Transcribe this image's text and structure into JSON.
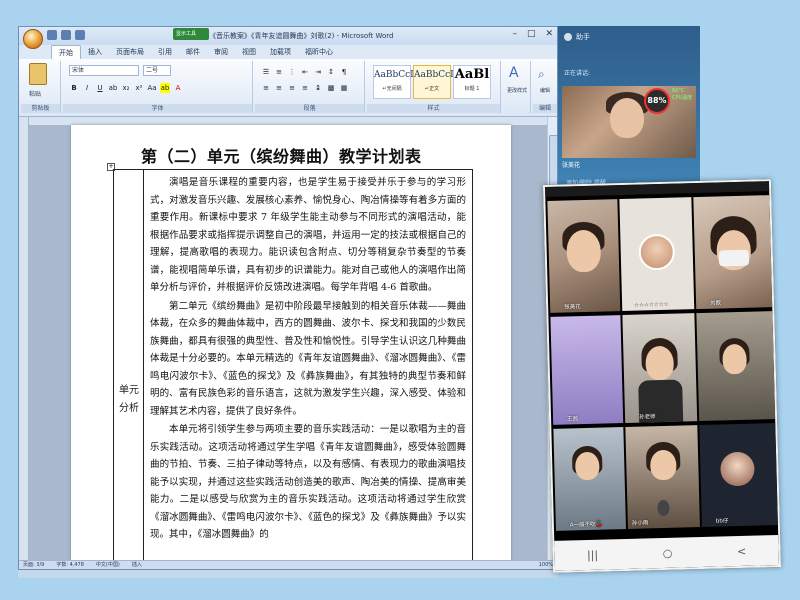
{
  "word": {
    "window_title": "《音乐教案》《青年友谊圆舞曲》刘歌(2) - Microsoft Word",
    "badge": "显示工具",
    "tabs": [
      "开始",
      "插入",
      "页面布局",
      "引用",
      "邮件",
      "审阅",
      "视图",
      "加载项",
      "福昕中心"
    ],
    "active_tab": "开始",
    "ribbon": {
      "paste_label": "粘贴",
      "font_name": "宋体",
      "font_size": "二号",
      "groups": [
        "剪贴板",
        "字体",
        "段落",
        "样式",
        "编辑"
      ],
      "styles": [
        {
          "sample": "AaBbCcDt",
          "name": "↵无间隔"
        },
        {
          "sample": "AaBbCcDt",
          "name": "↵正文"
        },
        {
          "sample": "AaBl",
          "name": "标题 1"
        }
      ],
      "change_styles": "更改样式",
      "edit_label": "编辑"
    },
    "document": {
      "title": "第（二）单元（缤纷舞曲）教学计划表",
      "left_cell_label": "单元分析",
      "paragraphs": [
        "演唱是音乐课程的重要内容，也是学生易于接受并乐于参与的学习形式，对激发音乐兴趣、发展核心素养、愉悦身心、陶冶情操等有着多方面的重要作用。新课标中要求 7 年级学生能主动参与不同形式的演唱活动，能根据作品要求或指挥提示调整自己的演唱，并运用一定的技法或根据自己的理解，提高歌唱的表现力。能识读包含附点、切分等稍复杂节奏型的节奏谱，能视唱简单乐谱，具有初步的识谱能力。能对自己或他人的演唱作出简单分析与评价，并根据评价反馈改进演唱。每学年背唱 4-6 首歌曲。",
        "第二单元《缤纷舞曲》是初中阶段最早接触到的相关音乐体裁——舞曲体裁，在众多的舞曲体裁中，西方的圆舞曲、波尔卡、探戈和我国的少数民族舞曲，都具有很强的典型性、普及性和愉悦性。引导学生认识这几种舞曲体裁是十分必要的。本单元精选的《青年友谊圆舞曲》、《溜冰圆舞曲》、《雷鸣电闪波尔卡》、《蓝色的探戈》及《彝族舞曲》，有其独特的典型节奏和鲜明的、富有民族色彩的音乐语言，这就为激发学生兴趣，深入感受、体验和理解其艺术内容，提供了良好条件。",
        "本单元将引领学生参与两项主要的音乐实践活动：一是以歌唱为主的音乐实践活动。这项活动将通过学生学唱《青年友谊圆舞曲》，感受体验圆舞曲的节拍、节奏、三拍子律动等特点，以及有感情、有表现力的歌曲演唱技能予以实现，并通过这些实践活动创造美的歌声、陶冶美的情操、提高审美能力。二是以感受与欣赏为主的音乐实践活动。这项活动将通过学生欣赏《溜冰圆舞曲》、《雷鸣电闪波尔卡》、《蓝色的探戈》及《彝族舞曲》予以实现。其中，《溜冰圆舞曲》的"
      ]
    },
    "status": {
      "page": "页面: 3/9",
      "words": "字数: 4,478",
      "lang": "中文(中国)",
      "mode": "插入",
      "zoom": "100%"
    }
  },
  "meeting_panel": {
    "app_name": "助手",
    "speaking_label": "正在讲话:",
    "speaker_name": "张美花",
    "cpu_percent": "88%",
    "cpu_temp": "60°C",
    "cpu_label": "CPU温度",
    "rows": [
      "添加/删除 提醒...",
      "",
      ""
    ]
  },
  "phone": {
    "participants": [
      {
        "name": "张美花"
      },
      {
        "name": "☆☆☆☆☆☆☆"
      },
      {
        "name": "刘歌"
      },
      {
        "name": "王茜"
      },
      {
        "name": "孙老师"
      },
      {
        "name": ""
      },
      {
        "name": "A一般不吃🍒"
      },
      {
        "name": "孙小雨"
      },
      {
        "name": "bb仔"
      }
    ],
    "nav": [
      "|||",
      "○",
      "<"
    ]
  },
  "colors": {
    "word_chrome": "#d5e3f3",
    "ribbon_highlight": "#e3b94a",
    "meeting_panel": "#3d7fb0",
    "cpu_ring": "#ee3333"
  }
}
